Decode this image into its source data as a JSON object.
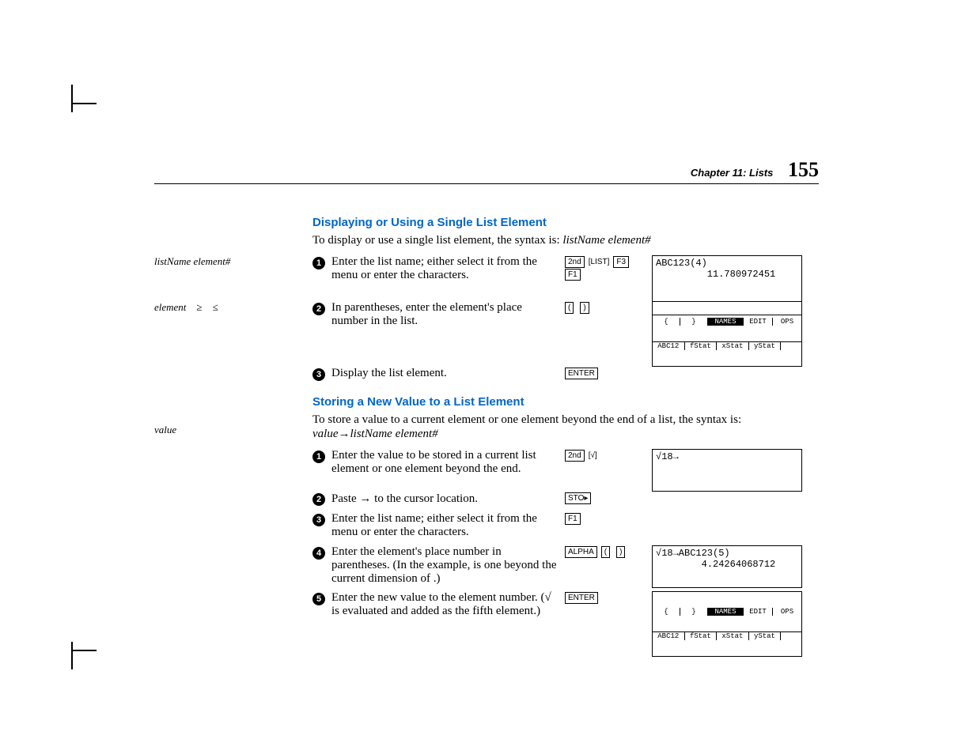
{
  "header": {
    "chapter": "Chapter 11: Lists",
    "page": "155"
  },
  "section1": {
    "title": "Displaying or Using a Single List Element",
    "intro_prefix": "To display or use a single list element, the syntax is:  ",
    "intro_syntax": "listName element#",
    "sidebar1": "listName element#",
    "sidebar2_a": "element",
    "sidebar2_b": "≥",
    "sidebar2_c": "≤",
    "steps": [
      {
        "num": "1",
        "text_a": "Enter the list name; either select it from the ",
        "text_b": " menu or enter the characters.",
        "keys": [
          "2nd",
          "[LIST]",
          "F3",
          "F1"
        ]
      },
      {
        "num": "2",
        "text": "In parentheses, enter the element's place number in the list.",
        "keys": [
          "(",
          ")"
        ]
      },
      {
        "num": "3",
        "text": "Display the list element.",
        "keys": [
          "ENTER"
        ]
      }
    ],
    "screen1_line1": "ABC123(4)",
    "screen1_line2": "         11.780972451",
    "menu_top": [
      "{",
      "}",
      "NAMES",
      "EDIT",
      "OPS"
    ],
    "menu_bot": [
      "ABC12",
      "fStat",
      "xStat",
      "yStat",
      ""
    ]
  },
  "section2": {
    "title": "Storing a New Value to a List Element",
    "intro": "To store a value to a current element or one element beyond the end of a list, the syntax is:",
    "syntax_a": "value",
    "syntax_arrow": "→",
    "syntax_b": "listName element#",
    "sidebar": "value",
    "steps": [
      {
        "num": "1",
        "text": "Enter the value to be stored in a current list element or one element beyond the end.",
        "keys": [
          "2nd",
          "[√]"
        ]
      },
      {
        "num": "2",
        "text_a": "Paste ",
        "text_arrow": "→",
        "text_b": " to the cursor location.",
        "keys": [
          "STO▸"
        ]
      },
      {
        "num": "3",
        "text_a": "Enter the list name; either select it from the ",
        "text_b": " menu or enter the characters.",
        "keys": [
          "F1"
        ]
      },
      {
        "num": "4",
        "text_a": "Enter the element's place number in parentheses. (In the example, ",
        "text_b": " is one beyond the current dimension of ",
        "text_c": ".)",
        "keys": [
          "ALPHA",
          "(",
          ")"
        ]
      },
      {
        "num": "5",
        "text_a": "Enter the new value to the element number. (√",
        "text_b": " is evaluated and added as the fifth element.)",
        "keys": [
          "ENTER"
        ]
      }
    ],
    "screen1": "√18→",
    "screen2_line1": "√18→ABC123(5)",
    "screen2_line2": "        4.24264068712",
    "menu_top": [
      "{",
      "}",
      "NAMES",
      "EDIT",
      "OPS"
    ],
    "menu_bot": [
      "ABC12",
      "fStat",
      "xStat",
      "yStat",
      ""
    ]
  }
}
